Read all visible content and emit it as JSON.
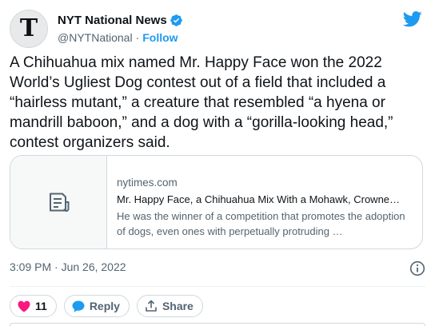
{
  "author": {
    "name": "NYT National News",
    "handle": "@NYTNational",
    "separator": "·",
    "follow_label": "Follow",
    "avatar_letter": "T",
    "verified": true
  },
  "tweet": {
    "text": "A Chihuahua mix named Mr. Happy Face won the 2022 World’s Ugliest Dog contest out of a field that included a “hairless mutant,” a creature that resembled “a hyena or mandrill baboon,” and a dog with a “gorilla-looking head,” contest organizers said."
  },
  "link_card": {
    "domain": "nytimes.com",
    "title": "Mr. Happy Face, a Chihuahua Mix With a Mohawk, Crowne…",
    "description": "He was the winner of a competition that promotes the adoption of dogs, even ones with perpetually protruding …",
    "icon": "article-icon"
  },
  "meta": {
    "timestamp": "3:09 PM · Jun 26, 2022",
    "info_icon": "info-icon"
  },
  "actions": {
    "like_count": "11",
    "reply_label": "Reply",
    "share_label": "Share"
  },
  "colors": {
    "accent": "#1d9bf0",
    "like": "#f91880",
    "text": "#0f1419",
    "muted": "#536471",
    "border": "#cfd9de"
  }
}
